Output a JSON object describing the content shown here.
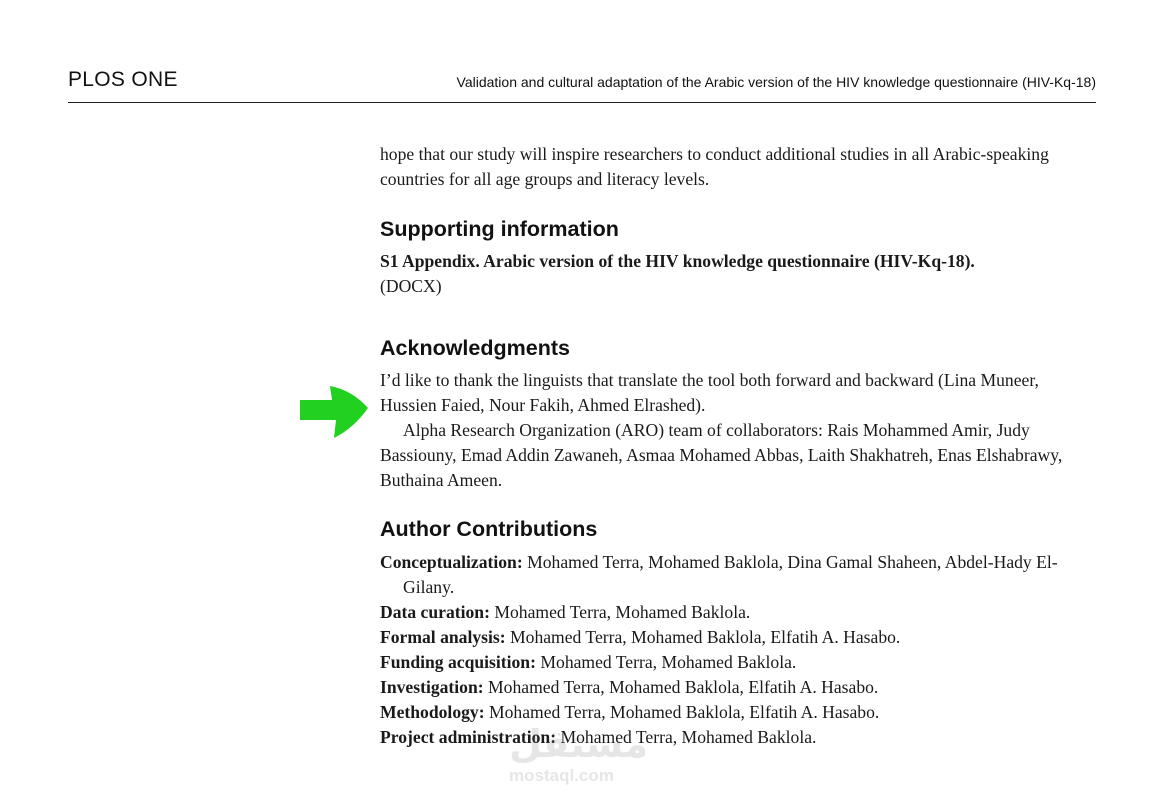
{
  "header": {
    "journal": "PLOS ONE",
    "running_title": "Validation and cultural adaptation of the Arabic version of the HIV knowledge questionnaire (HIV-Kq-18)"
  },
  "intro_paragraph": "hope that our study will inspire researchers to conduct additional studies in all Arabic-speaking countries for all age groups and literacy levels.",
  "supporting": {
    "heading": "Supporting information",
    "appendix_title": "S1 Appendix. Arabic version of the HIV knowledge questionnaire (HIV-Kq-18).",
    "appendix_format": "(DOCX)"
  },
  "acknowledgments": {
    "heading": "Acknowledgments",
    "paragraph1": "I’d like to thank the linguists that translate the tool both forward and backward (Lina Muneer, Hussien Faied, Nour Fakih, Ahmed Elrashed).",
    "paragraph2": "Alpha Research Organization (ARO) team of collaborators: Rais Mohammed Amir, Judy Bassiouny, Emad Addin Zawaneh, Asmaa Mohamed Abbas, Laith Shakhatreh, Enas Elshabrawy, Buthaina Ameen."
  },
  "author_contributions": {
    "heading": "Author Contributions",
    "items": [
      {
        "role": "Conceptualization:",
        "names": "Mohamed Terra, Mohamed Baklola, Dina Gamal Shaheen, Abdel-Hady El-Gilany."
      },
      {
        "role": "Data curation:",
        "names": "Mohamed Terra, Mohamed Baklola."
      },
      {
        "role": "Formal analysis:",
        "names": "Mohamed Terra, Mohamed Baklola, Elfatih A. Hasabo."
      },
      {
        "role": "Funding acquisition:",
        "names": "Mohamed Terra, Mohamed Baklola."
      },
      {
        "role": "Investigation:",
        "names": "Mohamed Terra, Mohamed Baklola, Elfatih A. Hasabo."
      },
      {
        "role": "Methodology:",
        "names": "Mohamed Terra, Mohamed Baklola, Elfatih A. Hasabo."
      },
      {
        "role": "Project administration:",
        "names": "Mohamed Terra, Mohamed Baklola."
      }
    ]
  },
  "annotation": {
    "arrow_color": "#22d11f",
    "arrow_icon": "green-arrow-right-icon"
  },
  "watermark": {
    "logo": "مستقل",
    "url": "mostaql.com"
  }
}
